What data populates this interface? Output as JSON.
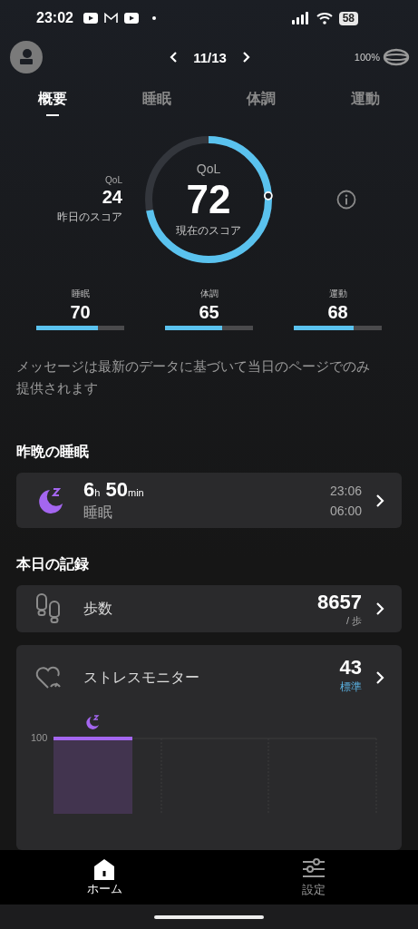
{
  "status_bar": {
    "time": "23:02",
    "battery": "58"
  },
  "header": {
    "page": "11/13",
    "ring_battery": "100%"
  },
  "tabs": [
    {
      "label": "概要",
      "selected": true
    },
    {
      "label": "睡眠",
      "selected": false
    },
    {
      "label": "体調",
      "selected": false
    },
    {
      "label": "運動",
      "selected": false
    }
  ],
  "qol": {
    "label": "QoL",
    "score": "72",
    "caption": "現在のスコア",
    "previous": {
      "label": "QoL",
      "score": "24",
      "caption": "昨日のスコア"
    }
  },
  "sub_scores": [
    {
      "label": "睡眠",
      "score": "70",
      "level": 0.7
    },
    {
      "label": "体調",
      "score": "65",
      "level": 0.65
    },
    {
      "label": "運動",
      "score": "68",
      "level": 0.68
    }
  ],
  "message": "メッセージは最新のデータに基づいて当日のページでのみ提供されます",
  "sleep_section": {
    "title": "昨晩の睡眠",
    "card": {
      "hours": "6",
      "hours_unit": "h",
      "minutes": "50",
      "minutes_unit": "min",
      "label": "睡眠",
      "start": "23:06",
      "end": "06:00"
    }
  },
  "records_section": {
    "title": "本日の記録",
    "items": [
      {
        "kind": "steps",
        "label": "歩数",
        "value": "8657",
        "unit": "/ 歩"
      },
      {
        "kind": "stress",
        "label": "ストレスモニター",
        "value": "43",
        "status": "標準",
        "axis_label": "100"
      }
    ]
  },
  "nav": [
    {
      "kind": "home",
      "label": "ホーム",
      "selected": true
    },
    {
      "kind": "settings",
      "label": "設定",
      "selected": false
    }
  ]
}
